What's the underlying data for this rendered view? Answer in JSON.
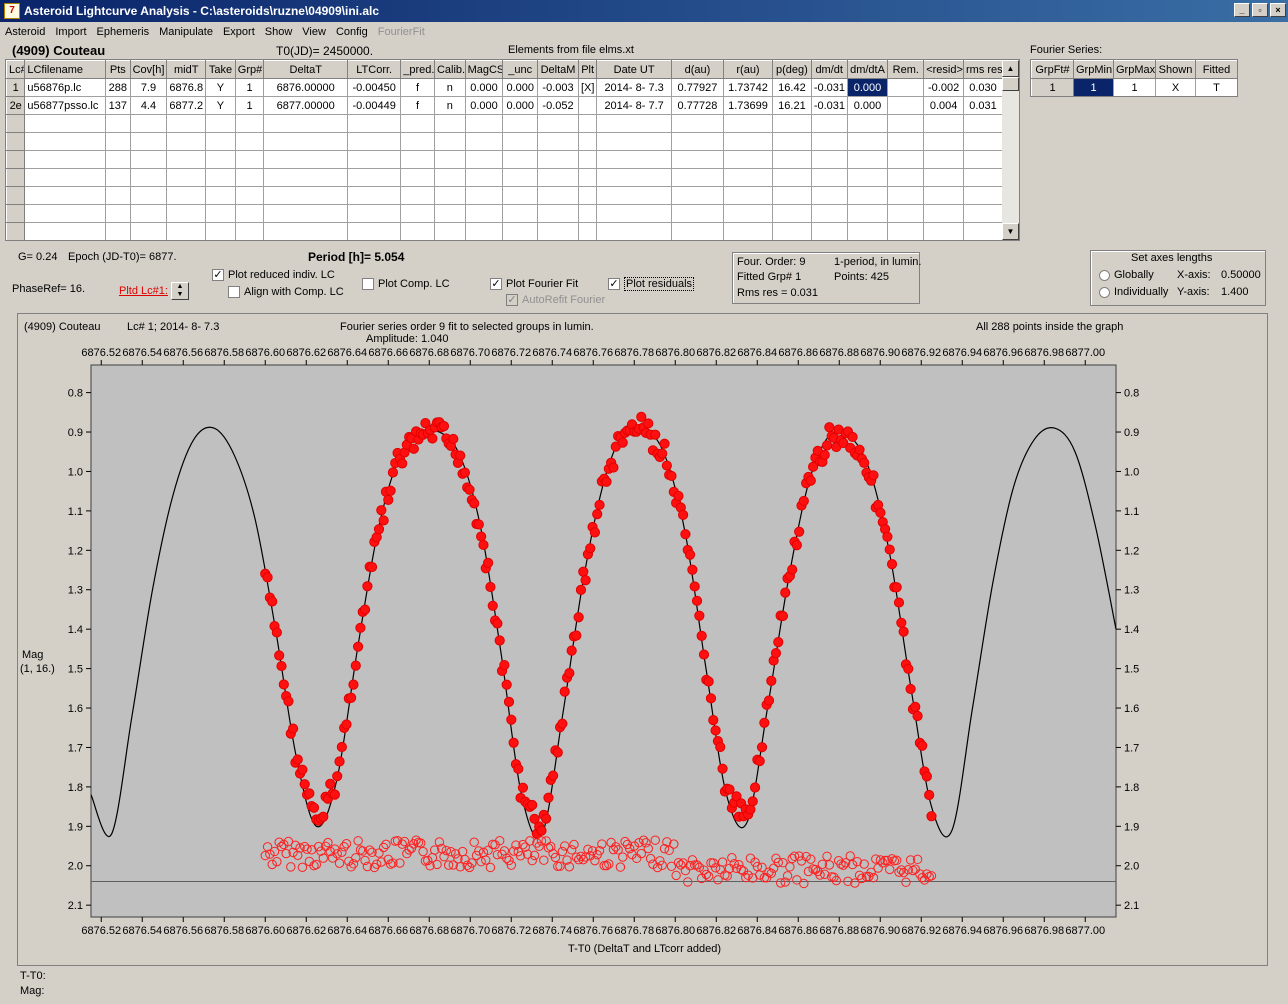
{
  "window": {
    "title": "Asteroid Lightcurve Analysis - C:\\asteroids\\ruzne\\04909\\ini.alc",
    "icon": "app-icon",
    "buttons": [
      "_",
      "▫",
      "×"
    ]
  },
  "menu": [
    {
      "label": "Asteroid"
    },
    {
      "label": "Import"
    },
    {
      "label": "Ephemeris"
    },
    {
      "label": "Manipulate"
    },
    {
      "label": "Export"
    },
    {
      "label": "Show"
    },
    {
      "label": "View"
    },
    {
      "label": "Config"
    },
    {
      "label": "FourierFit",
      "disabled": true
    }
  ],
  "header": {
    "asteroid": "(4909) Couteau",
    "t0": "T0(JD)= 2450000.",
    "elements": "Elements from file elms.xt",
    "fourier_label": "Fourier Series:"
  },
  "lc_table": {
    "columns": [
      "Lc#",
      "LCfilename",
      "Pts",
      "Cov[h]",
      "midT",
      "Take",
      "Grp#",
      "DeltaT",
      "LTCorr.",
      "_pred.",
      "Calib.",
      "MagCS",
      "_unc",
      "DeltaM",
      "Plt",
      "Date UT",
      "d(au)",
      "r(au)",
      "p(deg)",
      "dm/dt",
      "dm/dtA",
      "Rem.",
      "<resid>",
      "rms res"
    ],
    "rows": [
      [
        "1",
        "u56876p.lc",
        "288",
        "7.9",
        "6876.8",
        "Y",
        "1",
        "6876.00000",
        "-0.00450",
        "f",
        "n",
        "0.000",
        "0.000",
        "-0.003",
        "[X]",
        "2014- 8- 7.3",
        "0.77927",
        "1.73742",
        "16.42",
        "-0.031",
        "0.000",
        "",
        "-0.002",
        "0.030"
      ],
      [
        "2e",
        "u56877psso.lc",
        "137",
        "4.4",
        "6877.2",
        "Y",
        "1",
        "6877.00000",
        "-0.00449",
        "f",
        "n",
        "0.000",
        "0.000",
        "-0.052",
        "",
        "2014- 8- 7.7",
        "0.77728",
        "1.73699",
        "16.21",
        "-0.031",
        "0.000",
        "",
        "0.004",
        "0.031"
      ]
    ],
    "empty_rows": 7
  },
  "fourier_table": {
    "columns": [
      "GrpFt#",
      "GrpMin",
      "GrpMax",
      "Shown",
      "Fitted"
    ],
    "rows": [
      [
        "1",
        "1",
        "1",
        "X",
        "T"
      ]
    ]
  },
  "controls": {
    "g": "G= 0.24",
    "epoch": "Epoch (JD-T0)= 6877.",
    "period": "Period [h]= 5.054",
    "phaseref": "PhaseRef= 16.",
    "pltd": "Pltd Lc#1:",
    "plot_reduced": "Plot reduced indiv. LC",
    "align": "Align with Comp. LC",
    "plot_comp": "Plot Comp. LC",
    "plot_fourier": "Plot Fourier Fit",
    "autorefit": "AutoRefit Fourier",
    "plot_resid": "Plot residuals",
    "check": "✓"
  },
  "info": {
    "order": "Four. Order:  9",
    "mode": "1-period, in lumin.",
    "fitted": "Fitted Grp# 1",
    "points": "Points: 425",
    "rms": "Rms res     = 0.031"
  },
  "axes_box": {
    "title": "Set axes lengths",
    "globally": "Globally",
    "individually": "Individually",
    "xlabel": "X-axis:",
    "xval": "0.50000",
    "ylabel": "Y-axis:",
    "yval": "1.400"
  },
  "plot": {
    "obj": "(4909) Couteau",
    "lc": "Lc# 1; 2014- 8- 7.3",
    "desc": "Fourier series order 9 fit to selected groups in lumin.",
    "amp": "Amplitude: 1.040",
    "inside": "All 288 points inside the graph",
    "ylabel1": "Mag",
    "ylabel2": "(1, 16.)",
    "xlabel": "T-T0 (DeltaT and LTcorr added)"
  },
  "status": {
    "t": "T-T0:",
    "mag": "Mag:"
  },
  "chart_data": {
    "type": "scatter",
    "x_range": [
      6876.515,
      6877.015
    ],
    "y_range": [
      0.73,
      2.13
    ],
    "y_inverted": true,
    "xticks": [
      6876.52,
      6876.54,
      6876.56,
      6876.58,
      6876.6,
      6876.62,
      6876.64,
      6876.66,
      6876.68,
      6876.7,
      6876.72,
      6876.74,
      6876.76,
      6876.78,
      6876.8,
      6876.82,
      6876.84,
      6876.86,
      6876.88,
      6876.9,
      6876.92,
      6876.94,
      6876.96,
      6876.98,
      6877.0
    ],
    "yticks": [
      0.8,
      0.9,
      1.0,
      1.1,
      1.2,
      1.3,
      1.4,
      1.5,
      1.6,
      1.7,
      1.8,
      1.9,
      2.0,
      2.1
    ],
    "fit_curve": {
      "x": [
        6876.515,
        6876.525,
        6876.535,
        6876.545,
        6876.555,
        6876.565,
        6876.575,
        6876.585,
        6876.595,
        6876.605,
        6876.615,
        6876.625,
        6876.635,
        6876.645,
        6876.655,
        6876.665,
        6876.675,
        6876.685,
        6876.695,
        6876.705,
        6876.715,
        6876.725,
        6876.735,
        6876.745,
        6876.755,
        6876.765,
        6876.775,
        6876.785,
        6876.795,
        6876.805,
        6876.815,
        6876.825,
        6876.835,
        6876.845,
        6876.855,
        6876.865,
        6876.875,
        6876.885,
        6876.895,
        6876.905,
        6876.915,
        6876.925,
        6876.935,
        6876.945,
        6876.955,
        6876.965,
        6876.975,
        6876.985,
        6876.995,
        6877.005,
        6877.015
      ],
      "y": [
        1.82,
        1.92,
        1.62,
        1.3,
        1.06,
        0.92,
        0.89,
        0.96,
        1.12,
        1.4,
        1.72,
        1.9,
        1.78,
        1.45,
        1.15,
        0.97,
        0.91,
        0.9,
        0.96,
        1.14,
        1.46,
        1.82,
        1.92,
        1.62,
        1.28,
        1.03,
        0.9,
        0.89,
        0.96,
        1.16,
        1.5,
        1.82,
        1.89,
        1.6,
        1.28,
        1.03,
        0.91,
        0.91,
        1.0,
        1.22,
        1.55,
        1.85,
        1.91,
        1.6,
        1.28,
        1.04,
        0.92,
        0.89,
        0.95,
        1.14,
        1.4
      ]
    },
    "points": {
      "x_start": 6876.6,
      "x_end": 6876.925,
      "count": 288
    },
    "residual_baseline": 2.04
  }
}
